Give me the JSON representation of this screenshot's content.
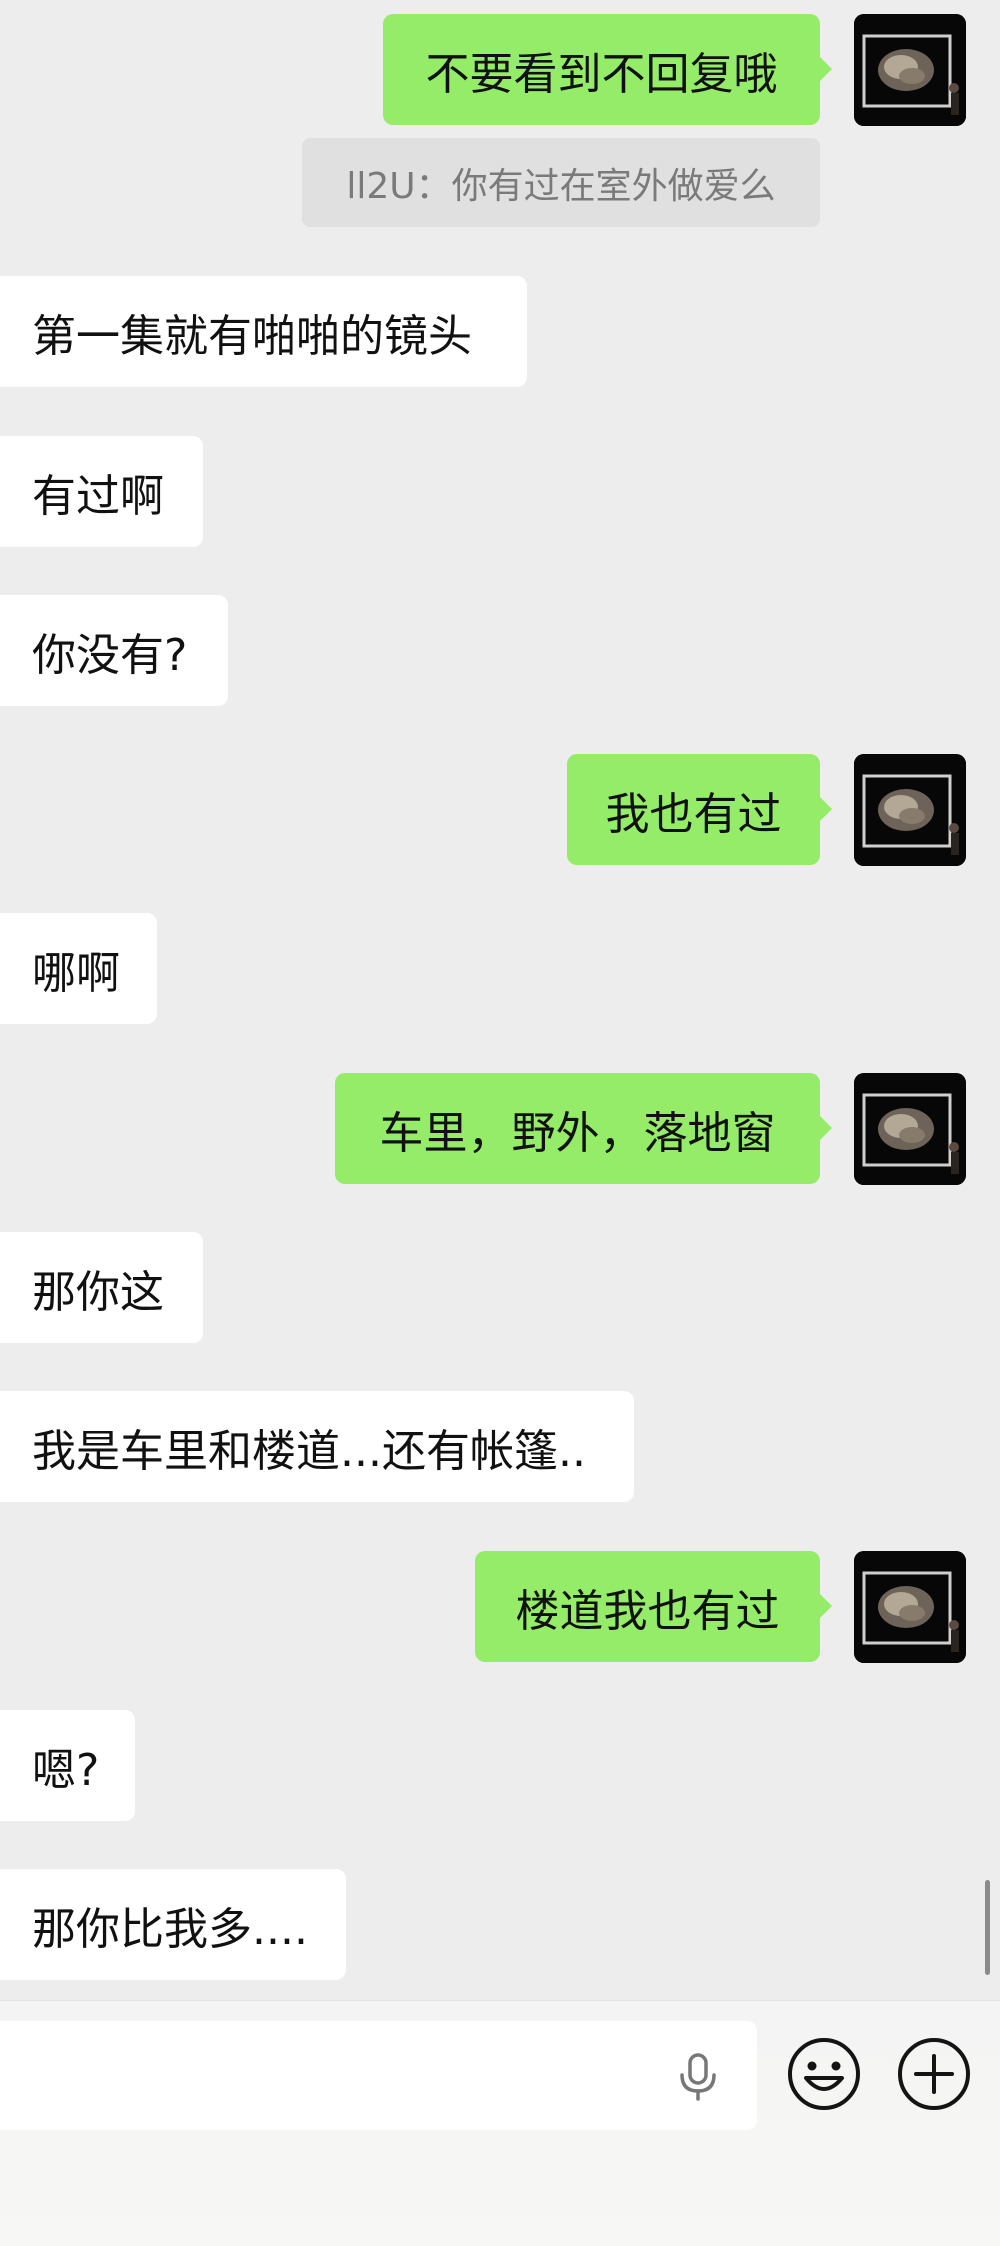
{
  "messages": [
    {
      "side": "right",
      "text": "不要看到不回复哦"
    },
    {
      "side": "quote",
      "text": "ll2U：你有过在室外做爱么"
    },
    {
      "side": "left",
      "text": "第一集就有啪啪的镜头"
    },
    {
      "side": "left",
      "text": "有过啊"
    },
    {
      "side": "left",
      "text": "你没有?"
    },
    {
      "side": "right",
      "text": "我也有过"
    },
    {
      "side": "left",
      "text": "哪啊"
    },
    {
      "side": "right",
      "text": "车里，野外，落地窗"
    },
    {
      "side": "left",
      "text": "那你这"
    },
    {
      "side": "left",
      "text": "我是车里和楼道...还有帐篷.."
    },
    {
      "side": "right",
      "text": "楼道我也有过"
    },
    {
      "side": "left",
      "text": "嗯?"
    },
    {
      "side": "left",
      "text": "那你比我多...."
    }
  ],
  "input_bar": {
    "icons": [
      "microphone-icon",
      "emoji-icon",
      "plus-icon"
    ]
  },
  "colors": {
    "background": "#ededed",
    "incoming_bubble": "#ffffff",
    "outgoing_bubble": "#95ec69",
    "quote_bubble": "#e0e0e0"
  }
}
